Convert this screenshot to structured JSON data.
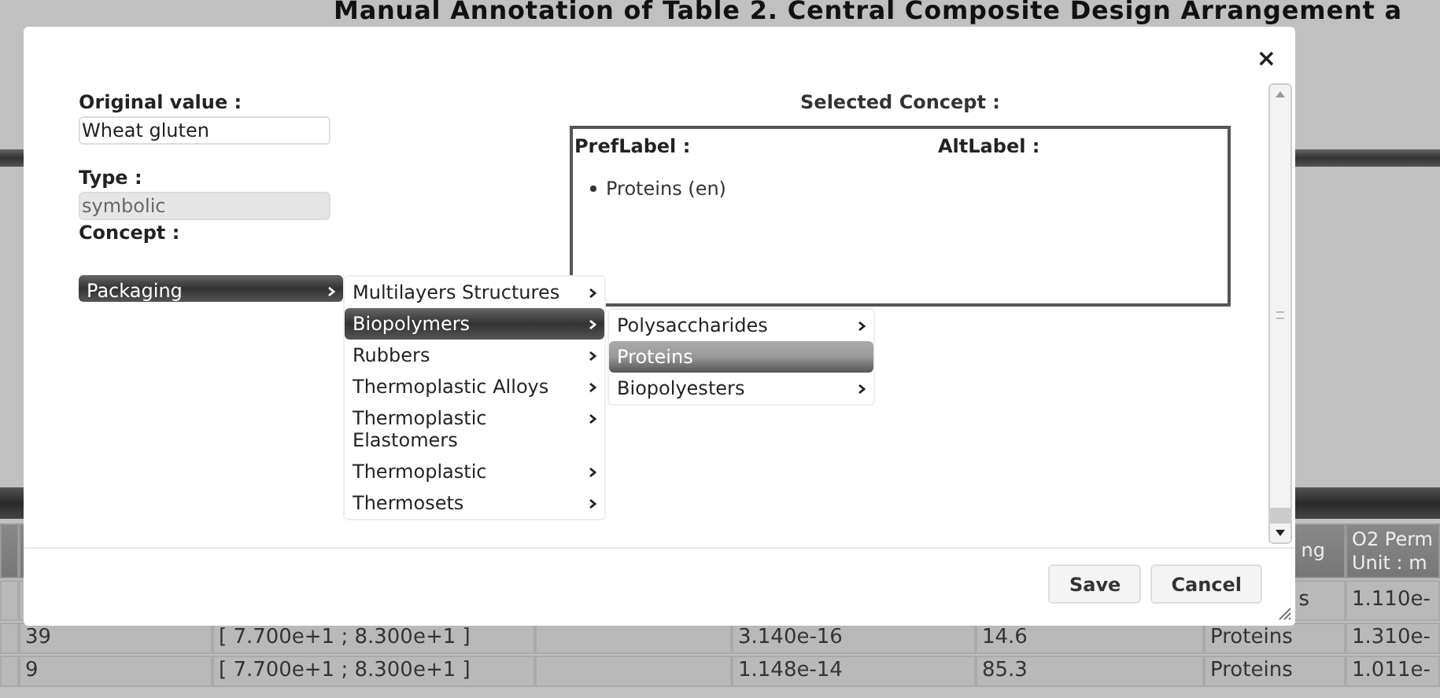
{
  "page": {
    "title": "Manual Annotation of Table 2. Central Composite Design Arrangement a"
  },
  "table": {
    "header": {
      "column_6": [
        "ng"
      ],
      "column_7": [
        "O2 Perm",
        "Unit : m"
      ]
    },
    "rows": [
      {
        "column_6": "s",
        "column_7": "1.110e-"
      },
      {
        "run": "39",
        "range": "[ 7.700e+1 ; 8.300e+1 ]",
        "value": "3.140e-16",
        "column_5": "14.6",
        "column_6": "Proteins",
        "column_7": "1.310e-"
      },
      {
        "run": "9",
        "range": "[ 7.700e+1 ; 8.300e+1 ]",
        "value": "1.148e-14",
        "column_5": "85.3",
        "column_6": "Proteins",
        "column_7": "1.011e-"
      }
    ]
  },
  "dialog": {
    "close": "×",
    "original_value": {
      "label": "Original value :",
      "value": "Wheat gluten"
    },
    "type": {
      "label": "Type :",
      "value": "symbolic",
      "disabled": true
    },
    "concept": {
      "label": "Concept :"
    },
    "menu": {
      "root": {
        "label": "Packaging",
        "selected": true,
        "has_submenu": true
      },
      "level_1": [
        {
          "label": "Multilayers Structures",
          "selected": false,
          "has_submenu": true
        },
        {
          "label": "Biopolymers",
          "selected": true,
          "has_submenu": true
        },
        {
          "label": "Rubbers",
          "selected": false,
          "has_submenu": true
        },
        {
          "label": "Thermoplastic Alloys",
          "selected": false,
          "has_submenu": true
        },
        {
          "label": "Thermoplastic Elastomers",
          "selected": false,
          "has_submenu": true
        },
        {
          "label": "Thermoplastic",
          "selected": false,
          "has_submenu": true
        },
        {
          "label": "Thermosets",
          "selected": false,
          "has_submenu": true
        }
      ],
      "level_2": [
        {
          "label": "Polysaccharides",
          "selected": false,
          "has_submenu": true
        },
        {
          "label": "Proteins",
          "selected": true,
          "has_submenu": false
        },
        {
          "label": "Biopolyesters",
          "selected": false,
          "has_submenu": true
        }
      ]
    },
    "selected_concept": {
      "title": "Selected Concept :",
      "pref_label_heading": "PrefLabel :",
      "alt_label_heading": "AltLabel :",
      "pref_labels": [
        "Proteins (en)"
      ]
    },
    "buttons": [
      {
        "label": "Save"
      },
      {
        "label": "Cancel"
      }
    ]
  }
}
